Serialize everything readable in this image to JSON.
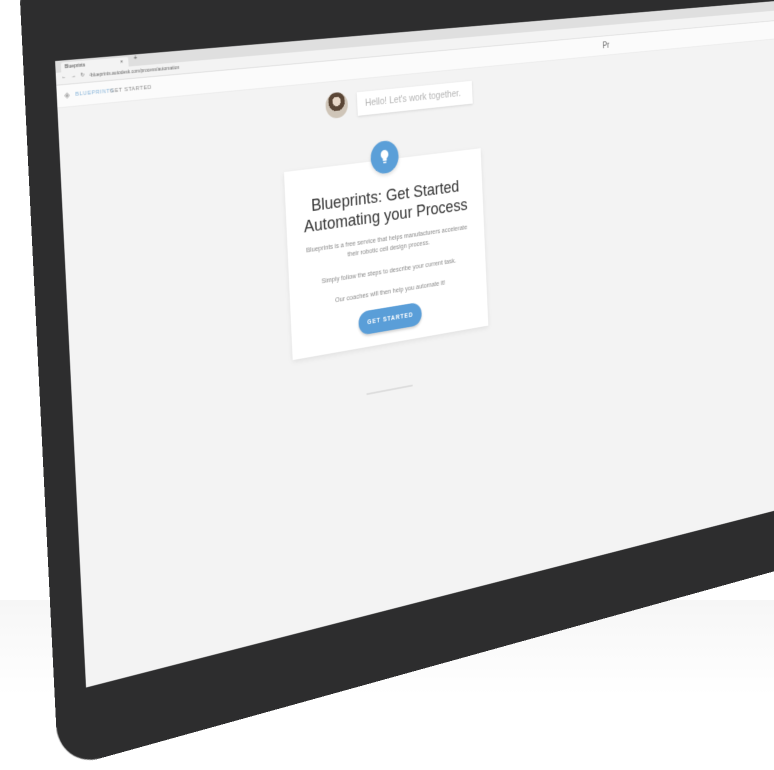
{
  "browser": {
    "tab_title": "Blueprints",
    "tab_close": "×",
    "new_tab": "+",
    "nav_icons": "← → ↻ ⌂",
    "url": "blueprints.autodesk.com/process/automation"
  },
  "header": {
    "brand": "BLUEPRINTS",
    "breadcrumb": "GET STARTED",
    "right_text": "Pr"
  },
  "greeting": {
    "message": "Hello! Let's work together."
  },
  "card": {
    "title_line1": "Blueprints: Get Started",
    "title_line2": "Automating your Process",
    "description": "Blueprints is a free service that helps manufacturers accelerate their robotic cell design process.",
    "step_text": "Simply follow the steps to describe your current task.",
    "coach_text": "Our coaches will then help you automate it!",
    "button_label": "GET STARTED"
  },
  "colors": {
    "accent": "#5b9fd8",
    "bezel": "#2d2d2e",
    "screen_bg": "#f3f3f3"
  },
  "icons": {
    "bulb": "lightbulb-icon",
    "logo": "blueprints-logo-icon"
  }
}
